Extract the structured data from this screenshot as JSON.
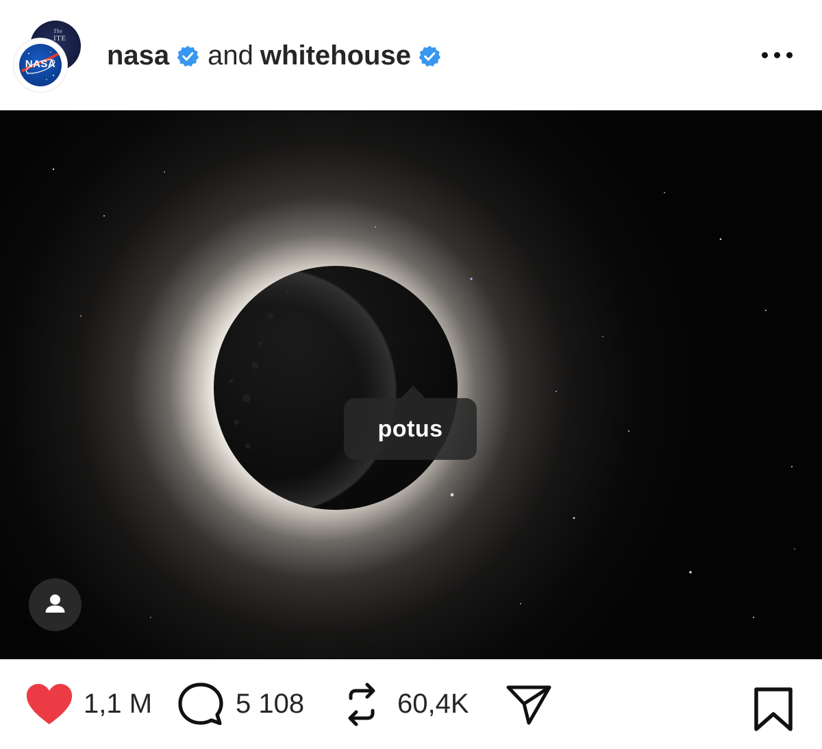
{
  "header": {
    "username_1": "nasa",
    "joiner": "and",
    "username_2": "whitehouse",
    "avatar_1_text": "The WHITE HOUSE",
    "avatar_2_text": "NASA",
    "verified_color": "#3897f0",
    "more_icon": "more-horizontal-icon"
  },
  "media": {
    "tag_label": "potus",
    "user_tag_icon": "person-icon"
  },
  "actions": {
    "like_count": "1,1 M",
    "like_color": "#ed3b45",
    "comment_count": "5 108",
    "repost_count": "60,4K",
    "icons": [
      "heart-icon",
      "comment-icon",
      "repost-icon",
      "share-icon",
      "bookmark-icon"
    ]
  }
}
